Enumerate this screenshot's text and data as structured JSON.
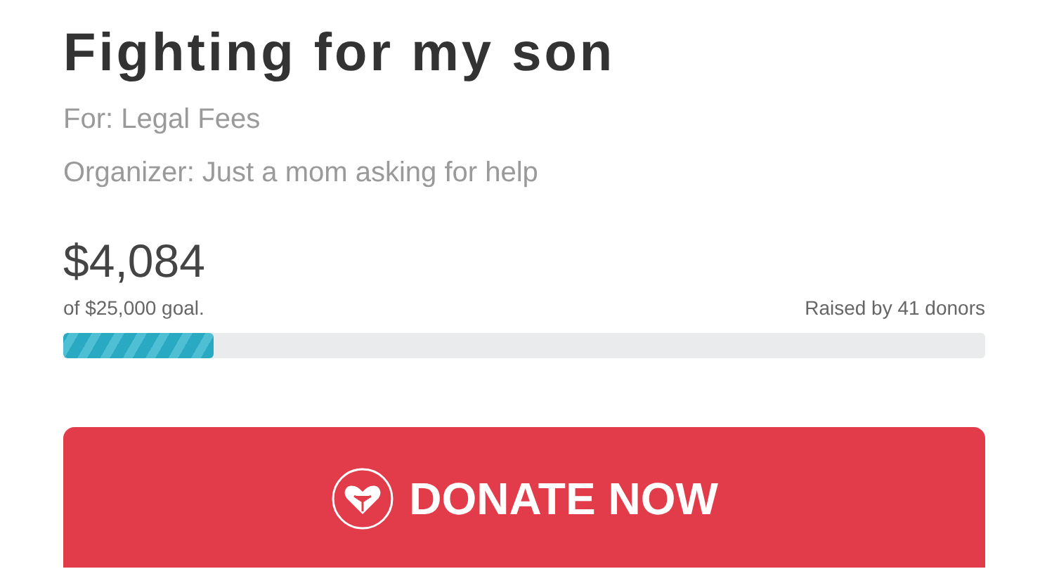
{
  "campaign": {
    "title": "Fighting for my son",
    "category": "For: Legal Fees",
    "organizer": "Organizer: Just a mom asking for help"
  },
  "progress": {
    "raised": "$4,084",
    "goal": "of $25,000 goal.",
    "donors": "Raised by 41 donors",
    "level": 0.163
  },
  "donate_button": {
    "label": "DONATE NOW"
  }
}
